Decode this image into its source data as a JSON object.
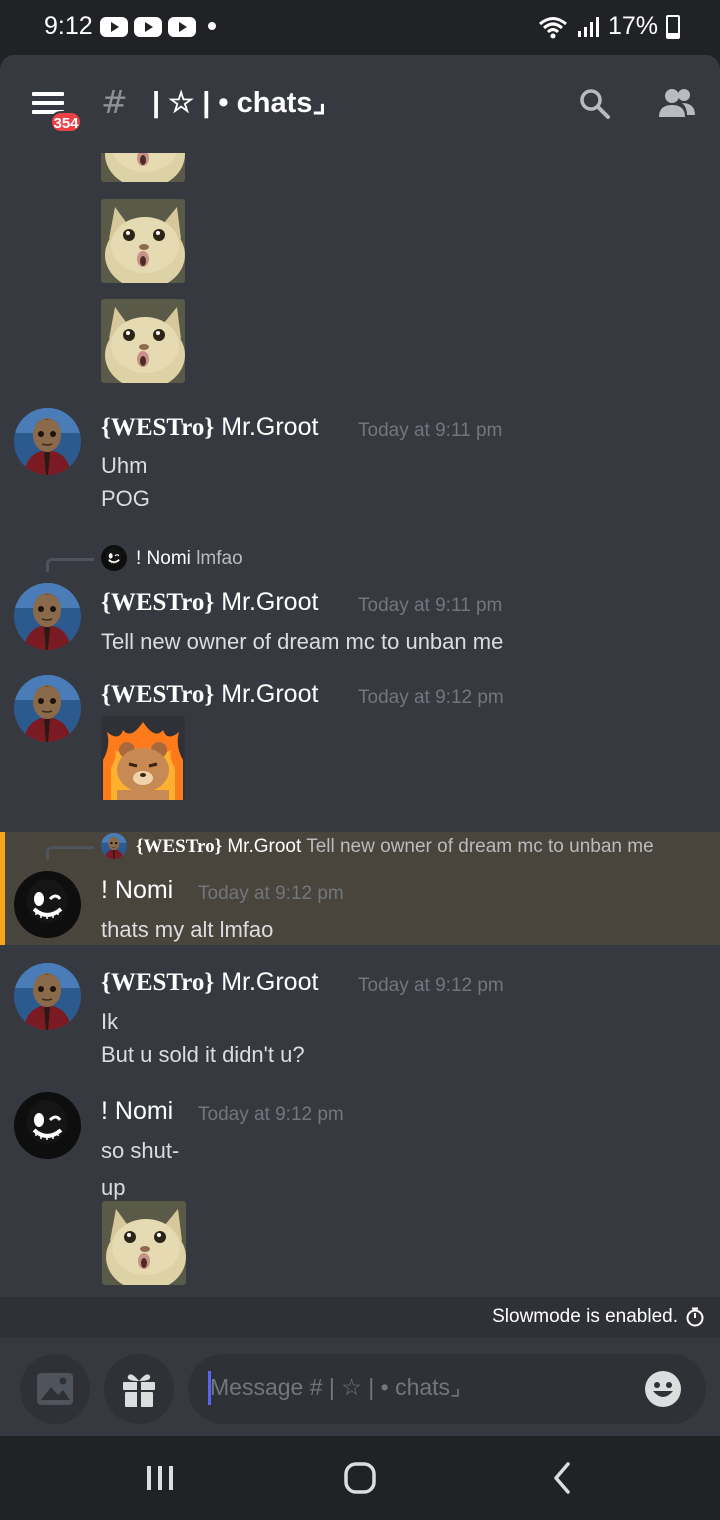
{
  "status_bar": {
    "time": "9:12",
    "battery": "17%"
  },
  "header": {
    "unread_badge": "354",
    "hash": "#",
    "channel_name": "| ☆ |  • chats⌟"
  },
  "messages": {
    "m1": {
      "username_tag": "{WESTro}",
      "username_name": " Mr.Groot",
      "timestamp": "Today at 9:11 pm",
      "lines": [
        "Uhm",
        "POG"
      ]
    },
    "m2": {
      "reply_name": "! Nomi",
      "reply_text": "lmfao",
      "username_tag": "{WESTro}",
      "username_name": " Mr.Groot",
      "timestamp": "Today at 9:11 pm",
      "lines": [
        "Tell new owner of dream mc to unban me"
      ]
    },
    "m3": {
      "username_tag": "{WESTro}",
      "username_name": " Mr.Groot",
      "timestamp": "Today at 9:12 pm"
    },
    "m4": {
      "reply_tag": "{WESTro}",
      "reply_name": " Mr.Groot",
      "reply_text": "Tell new owner of dream mc to unban me",
      "username": "! Nomi",
      "timestamp": "Today at 9:12 pm",
      "lines": [
        "thats my alt lmfao"
      ]
    },
    "m5": {
      "username_tag": "{WESTro}",
      "username_name": " Mr.Groot",
      "timestamp": "Today at 9:12 pm",
      "lines": [
        "Ik",
        "But u sold it didn't u?"
      ]
    },
    "m6": {
      "username": "! Nomi",
      "timestamp": "Today at 9:12 pm",
      "lines": [
        "so shut-",
        "up"
      ]
    }
  },
  "slowmode": {
    "text": "Slowmode is enabled."
  },
  "composer": {
    "placeholder": "Message # | ☆ |  • chats⌟"
  },
  "icons": {
    "menu": "hamburger-icon",
    "search": "search-icon",
    "members": "members-icon",
    "image": "image-icon",
    "gift": "gift-icon",
    "emoji": "emoji-icon",
    "timer": "timer-icon",
    "nav_recent": "recent-apps-icon",
    "nav_home": "home-icon",
    "nav_back": "back-icon"
  },
  "colors": {
    "background": "#36393f",
    "mention_highlight": "#49443c",
    "mention_bar": "#faa61a",
    "badge": "#ed4245",
    "accent": "#5865f2"
  }
}
